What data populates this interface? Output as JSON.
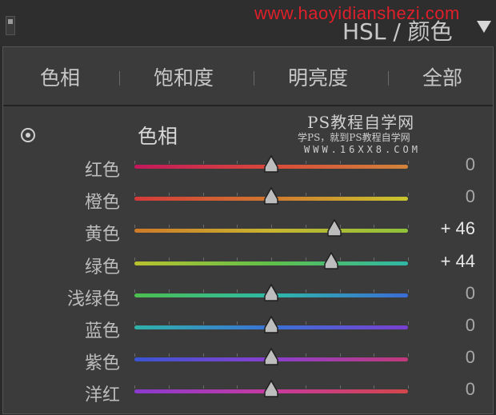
{
  "header": {
    "watermark_url": "www.haoyidianshezi.com",
    "panel_title": "HSL / 颜色"
  },
  "tabs": [
    {
      "label": "色相",
      "active": true
    },
    {
      "label": "饱和度",
      "active": false
    },
    {
      "label": "明亮度",
      "active": false
    },
    {
      "label": "全部",
      "active": false
    }
  ],
  "section": {
    "title": "色相"
  },
  "watermark": {
    "line1": "PS教程自学网",
    "line2": "学PS，就到PS教程自学网",
    "line3": "WWW.16XX8.COM"
  },
  "sliders": [
    {
      "label": "红色",
      "value": "0",
      "level": 0.5,
      "gradient": [
        "#c2185b",
        "#d84a3a",
        "#d2843a"
      ],
      "changed": false
    },
    {
      "label": "橙色",
      "value": "0",
      "level": 0.5,
      "gradient": [
        "#d33a3a",
        "#d1782e",
        "#c8c62e"
      ],
      "changed": false
    },
    {
      "label": "黄色",
      "value": "+ 46",
      "level": 0.73,
      "gradient": [
        "#cf7a28",
        "#c7b430",
        "#8fc23a"
      ],
      "changed": true
    },
    {
      "label": "绿色",
      "value": "+ 44",
      "level": 0.72,
      "gradient": [
        "#b9c12e",
        "#5fc04a",
        "#2fb7a6"
      ],
      "changed": true
    },
    {
      "label": "浅绿色",
      "value": "0",
      "level": 0.5,
      "gradient": [
        "#4cbf4f",
        "#2ebaa7",
        "#3a6cd6"
      ],
      "changed": false
    },
    {
      "label": "蓝色",
      "value": "0",
      "level": 0.5,
      "gradient": [
        "#2fb2a8",
        "#3a72d6",
        "#7a3fcf"
      ],
      "changed": false
    },
    {
      "label": "紫色",
      "value": "0",
      "level": 0.5,
      "gradient": [
        "#3a55d2",
        "#8a3fcf",
        "#c23a7a"
      ],
      "changed": false
    },
    {
      "label": "洋红",
      "value": "0",
      "level": 0.5,
      "gradient": [
        "#8a3acf",
        "#c73aa0",
        "#d2464a"
      ],
      "changed": false
    }
  ]
}
